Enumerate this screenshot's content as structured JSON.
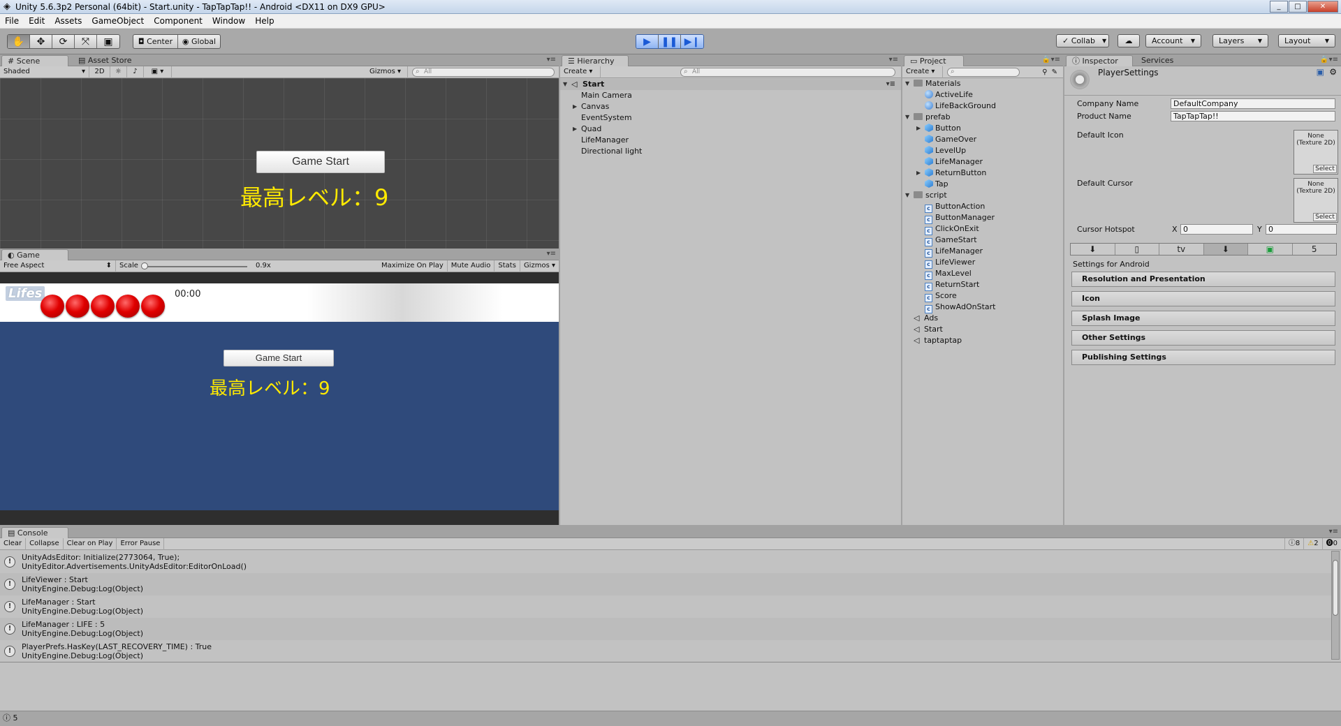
{
  "window": {
    "title": "Unity 5.6.3p2 Personal (64bit) - Start.unity - TapTapTap!! - Android <DX11 on DX9 GPU>",
    "controls": [
      "_",
      "□",
      "✕"
    ]
  },
  "menu": [
    "File",
    "Edit",
    "Assets",
    "GameObject",
    "Component",
    "Window",
    "Help"
  ],
  "toolbar": {
    "tools": [
      "hand-icon",
      "move-icon",
      "rotate-icon",
      "scale-icon",
      "rect-icon"
    ],
    "pivot": "Center",
    "space": "Global",
    "collab": "Collab",
    "account": "Account",
    "layers": "Layers",
    "layout": "Layout"
  },
  "scene": {
    "tabs": [
      "Scene",
      "Asset Store"
    ],
    "shading": "Shaded",
    "mode_2d": "2D",
    "gizmos": "Gizmos",
    "search_placeholder": "All",
    "button_label": "Game Start",
    "level_text": "最高レベル：9"
  },
  "game": {
    "tab": "Game",
    "aspect": "Free Aspect",
    "scale_label": "Scale",
    "scale_value": "0.9x",
    "toolbar": [
      "Maximize On Play",
      "Mute Audio",
      "Stats",
      "Gizmos"
    ],
    "lifes_label": "Lifes",
    "life_count": 5,
    "timer": "00:00",
    "button_label": "Game Start",
    "level_text": "最高レベル：9"
  },
  "hierarchy": {
    "tab": "Hierarchy",
    "create": "Create",
    "search_placeholder": "All",
    "scene_name": "Start",
    "items": [
      "Main Camera",
      "Canvas",
      "EventSystem",
      "Quad",
      "LifeManager",
      "Directional light"
    ]
  },
  "project": {
    "tab": "Project",
    "create": "Create",
    "materials": {
      "name": "Materials",
      "items": [
        "ActiveLife",
        "LifeBackGround"
      ]
    },
    "prefab": {
      "name": "prefab",
      "items": [
        "Button",
        "GameOver",
        "LevelUp",
        "LifeManager",
        "ReturnButton",
        "Tap"
      ]
    },
    "script": {
      "name": "script",
      "items": [
        "ButtonAction",
        "ButtonManager",
        "ClickOnExit",
        "GameStart",
        "LifeManager",
        "LifeViewer",
        "MaxLevel",
        "ReturnStart",
        "Score",
        "ShowAdOnStart"
      ]
    },
    "scenes": [
      "Ads",
      "Start",
      "taptaptap"
    ]
  },
  "inspector": {
    "tabs": [
      "Inspector",
      "Services"
    ],
    "title": "PlayerSettings",
    "company_label": "Company Name",
    "company_value": "DefaultCompany",
    "product_label": "Product Name",
    "product_value": "TapTapTap!!",
    "icon_label": "Default Icon",
    "cursor_label": "Default Cursor",
    "tex_none": "None (Texture 2D)",
    "tex_select": "Select",
    "hotspot_label": "Cursor Hotspot",
    "hotspot_x_label": "X",
    "hotspot_x": "0",
    "hotspot_y_label": "Y",
    "hotspot_y": "0",
    "platforms": [
      "⬇",
      "▯",
      "tv",
      "⬇",
      "▣",
      "5"
    ],
    "settings_for": "Settings for Android",
    "sections": [
      "Resolution and Presentation",
      "Icon",
      "Splash Image",
      "Other Settings",
      "Publishing Settings"
    ]
  },
  "console": {
    "tab": "Console",
    "buttons": [
      "Clear",
      "Collapse",
      "Clear on Play",
      "Error Pause"
    ],
    "count_info": "8",
    "count_warn": "2",
    "count_error": "0",
    "entries": [
      {
        "line1": "UnityAdsEditor: Initialize(2773064, True);",
        "line2": "UnityEditor.Advertisements.UnityAdsEditor:EditorOnLoad()"
      },
      {
        "line1": "LifeViewer : Start",
        "line2": "UnityEngine.Debug:Log(Object)"
      },
      {
        "line1": "LifeManager : Start",
        "line2": "UnityEngine.Debug:Log(Object)"
      },
      {
        "line1": "LifeManager : LIFE : 5",
        "line2": "UnityEngine.Debug:Log(Object)"
      },
      {
        "line1": "PlayerPrefs.HasKey(LAST_RECOVERY_TIME) : True",
        "line2": "UnityEngine.Debug:Log(Object)"
      }
    ]
  },
  "statusbar": {
    "text": "5"
  }
}
